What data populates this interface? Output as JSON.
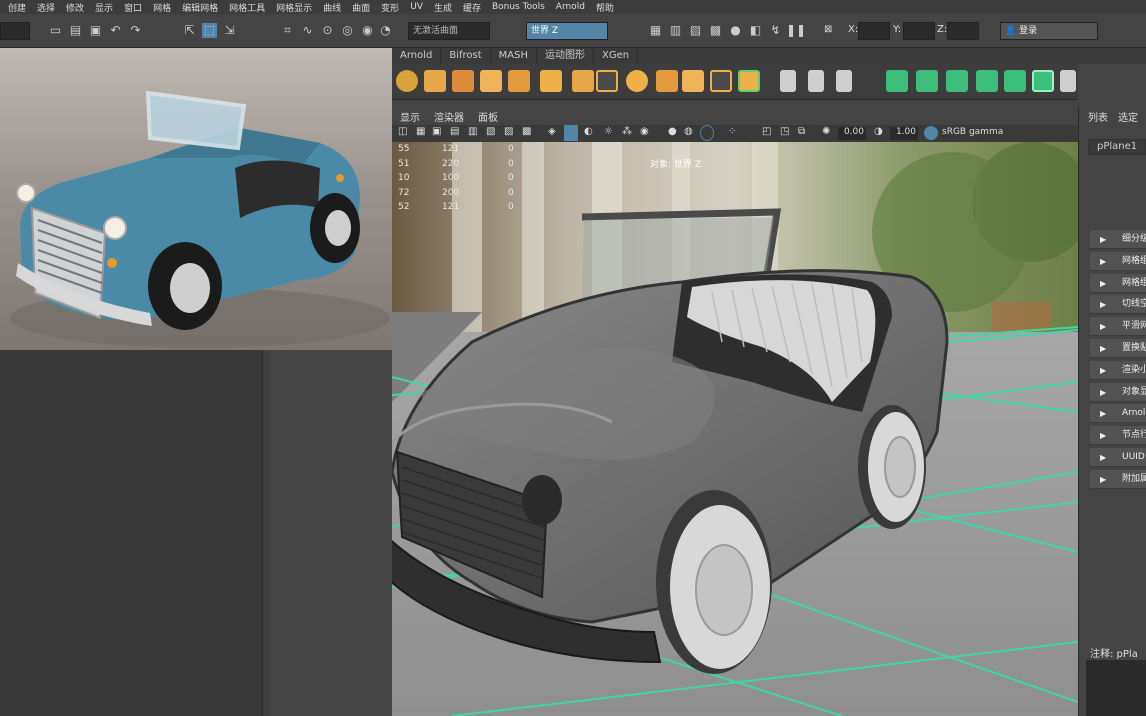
{
  "menu": [
    "创建",
    "选择",
    "修改",
    "显示",
    "窗口",
    "网格",
    "编辑网格",
    "网格工具",
    "网格显示",
    "曲线",
    "曲面",
    "变形",
    "UV",
    "生成",
    "缓存",
    "Bonus Tools",
    "Arnold",
    "帮助"
  ],
  "status": {
    "live_surface": "无激活曲面",
    "space": "世界 Z",
    "x_label": "X:",
    "y_label": "Y:",
    "z_label": "Z:",
    "login": "登录"
  },
  "shelf_tabs": [
    "Arnold",
    "Bifrost",
    "MASH",
    "运动图形",
    "XGen"
  ],
  "viewport_menu": [
    "显示",
    "渲染器",
    "面板"
  ],
  "viewport_toolbar": {
    "exposure": "0.00",
    "gamma": "1.00",
    "colorspace": "sRGB gamma"
  },
  "hud": {
    "rows": [
      {
        "a": "55",
        "b": "121",
        "c": "0"
      },
      {
        "a": "51",
        "b": "220",
        "c": "0"
      },
      {
        "a": "10",
        "b": "100",
        "c": "0"
      },
      {
        "a": "72",
        "b": "200",
        "c": "0"
      },
      {
        "a": "52",
        "b": "121",
        "c": "0"
      }
    ],
    "object_label": "对象: 世界 Z"
  },
  "right_panel": {
    "tabs": [
      "列表",
      "选定"
    ],
    "object_name": "pPlane1",
    "sections": [
      "细分级",
      "网格组",
      "网格组",
      "切线空",
      "平滑网",
      "置换贴",
      "渲染小",
      "对象显",
      "Arnold",
      "节点行",
      "UUID",
      "附加属"
    ],
    "notes_label": "注释: pPla"
  },
  "colors": {
    "accent_blue": "#5285a6",
    "grid_green": "#3fd6a8",
    "car_paint": "#4a8aa6"
  }
}
